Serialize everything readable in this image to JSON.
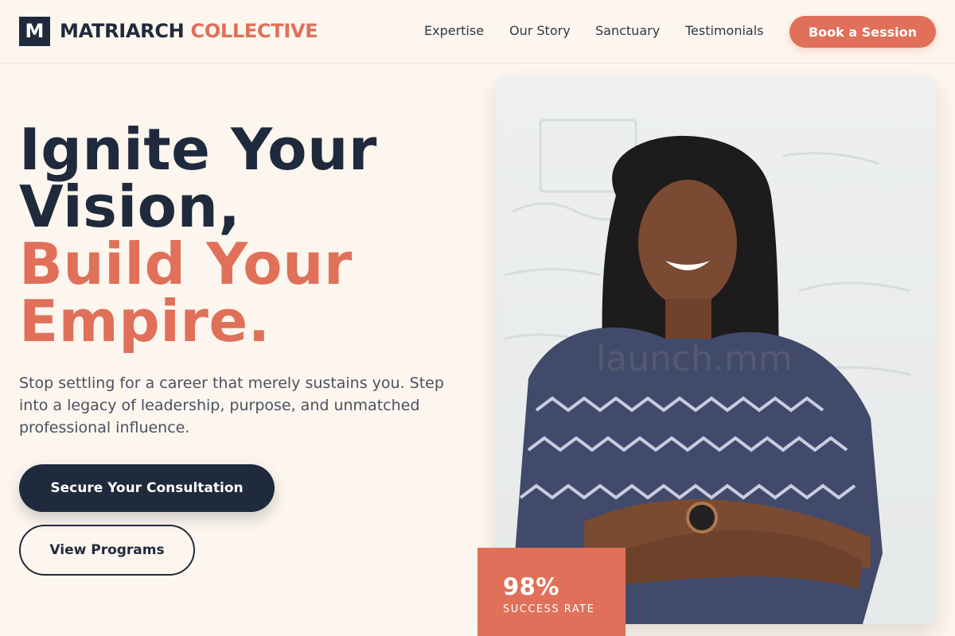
{
  "header": {
    "logo_mark": "M",
    "logo_primary": "MATRIARCH",
    "logo_accent": "COLLECTIVE",
    "nav": [
      {
        "label": "Expertise"
      },
      {
        "label": "Our Story"
      },
      {
        "label": "Sanctuary"
      },
      {
        "label": "Testimonials"
      }
    ],
    "cta_label": "Book a Session"
  },
  "hero": {
    "headline_dark": [
      "Ignite Your",
      "Vision,"
    ],
    "headline_accent": [
      "Build Your",
      "Empire."
    ],
    "subtext": "Stop settling for a career that merely sustains you. Step into a legacy of leadership, purpose, and unmatched professional influence.",
    "primary_cta": "Secure Your Consultation",
    "secondary_cta": "View Programs"
  },
  "photo": {
    "watermark": "launch.mm"
  },
  "stat": {
    "value": "98%",
    "label": "SUCCESS RATE"
  },
  "colors": {
    "background": "#fdf6ee",
    "navy": "#1f2a3d",
    "accent": "#e07059"
  }
}
